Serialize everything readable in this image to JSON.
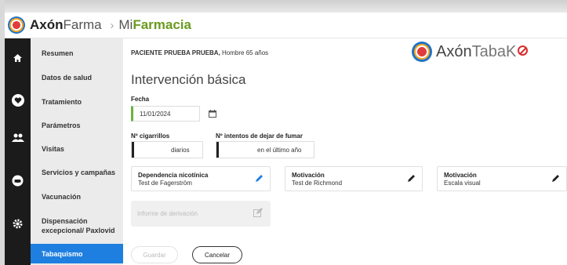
{
  "header": {
    "brand_bold": "Axón",
    "brand_light": "Farma",
    "separator": "›",
    "app_prefix": "Mi",
    "app_name": "Farmacia"
  },
  "rail_icons": [
    "home-icon",
    "heart-icon",
    "users-icon",
    "car-icon",
    "gear-icon"
  ],
  "sidebar": {
    "items": [
      {
        "label": "Resumen"
      },
      {
        "label": "Datos de salud"
      },
      {
        "label": "Tratamiento"
      },
      {
        "label": "Parámetros"
      },
      {
        "label": "Visitas"
      },
      {
        "label": "Servicios y campañas"
      },
      {
        "label": "Vacunación"
      },
      {
        "label": "Dispensación excepcional/ Paxlovid"
      },
      {
        "label": "Tabaquismo",
        "active": true
      }
    ]
  },
  "main": {
    "patient_name": "PACIENTE PRUEBA PRUEBA,",
    "patient_info": " Hombre 65 años",
    "tabako_prefix": "Axón",
    "tabako_name": "TabaK",
    "title": "Intervención básica",
    "fecha_label": "Fecha",
    "fecha_value": "11/01/2024",
    "cigarrillos_label": "Nº cigarrillos",
    "cigarrillos_suffix": "diarios",
    "intentos_label": "Nº intentos de dejar de fumar",
    "intentos_suffix": "en el último año",
    "cards": [
      {
        "title": "Dependencia nicotínica",
        "subtitle": "Test de Fagerström",
        "icon_color": "#1f7fe0"
      },
      {
        "title": "Motivación",
        "subtitle": "Test de Richmond",
        "icon_color": "#222222"
      },
      {
        "title": "Motivación",
        "subtitle": "Escala visual",
        "icon_color": "#222222"
      }
    ],
    "report_placeholder": "Informe de derivación",
    "save_label": "Guardar",
    "cancel_label": "Cancelar"
  },
  "colors": {
    "accent": "#1f7fe0",
    "brand_green": "#6a9a1f",
    "date_border": "#6db33f",
    "rail_bg": "#1b1b1b",
    "sidebar_bg": "#ebebeb"
  }
}
